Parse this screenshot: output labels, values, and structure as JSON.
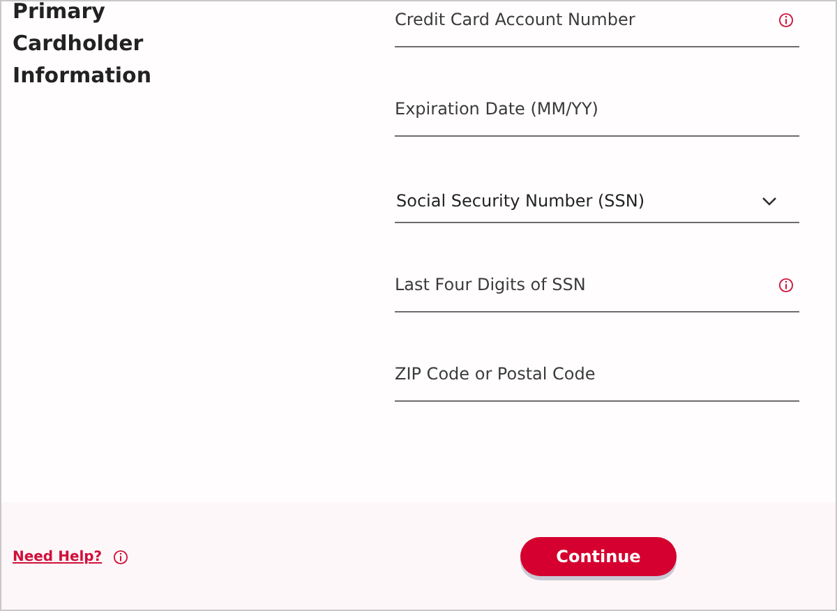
{
  "section_title": "Primary Cardholder Information",
  "fields": [
    {
      "kind": "text",
      "placeholder": "Credit Card Account Number",
      "info": true
    },
    {
      "kind": "text",
      "placeholder": "Expiration Date (MM/YY)",
      "info": false
    },
    {
      "kind": "select",
      "label": "Social Security Number (SSN)"
    },
    {
      "kind": "text",
      "placeholder": "Last Four Digits of SSN",
      "info": true
    },
    {
      "kind": "text",
      "placeholder": "ZIP Code or Postal Code",
      "info": false
    }
  ],
  "footer": {
    "help_link": "Need Help?",
    "button": "Continue"
  }
}
